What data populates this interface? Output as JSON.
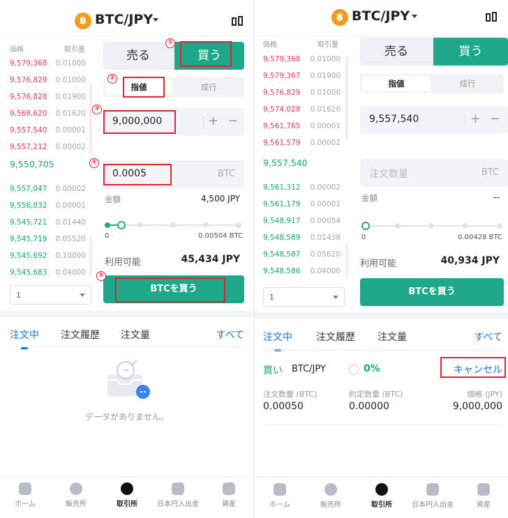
{
  "left": {
    "header": {
      "pair": "BTC/JPY",
      "coin_glyph": "฿"
    },
    "orderbook": {
      "price_header": "価格",
      "qty_header": "取引量",
      "asks": [
        {
          "price": "9,579,368",
          "qty": "0.01000"
        },
        {
          "price": "9,576,829",
          "qty": "0.01000"
        },
        {
          "price": "9,576,828",
          "qty": "0.01900"
        },
        {
          "price": "9,568,620",
          "qty": "0.01620"
        },
        {
          "price": "9,557,540",
          "qty": "0.00001"
        },
        {
          "price": "9,557,212",
          "qty": "0.00002"
        }
      ],
      "mid": "9,550,705",
      "bids": [
        {
          "price": "9,557,047",
          "qty": "0.00002"
        },
        {
          "price": "9,556,832",
          "qty": "0.00001"
        },
        {
          "price": "9,545,721",
          "qty": "0.01440"
        },
        {
          "price": "9,545,719",
          "qty": "0.05520"
        },
        {
          "price": "9,545,692",
          "qty": "0.10000"
        },
        {
          "price": "9,545,683",
          "qty": "0.04000"
        }
      ],
      "group_value": "1"
    },
    "form": {
      "sell_label": "売る",
      "buy_label": "買う",
      "limit_label": "指値",
      "market_label": "成行",
      "price_value": "9,000,000",
      "qty_value": "0.0005",
      "qty_unit": "BTC",
      "amount_label": "金額",
      "amount_value": "4,500 JPY",
      "slider_min": "0",
      "slider_max": "0.00504 BTC",
      "slider_fraction": 0.12,
      "avail_label": "利用可能",
      "avail_value": "45,434 JPY",
      "submit_label": "BTCを買う"
    },
    "tabs": {
      "open": "注文中",
      "history": "注文履歴",
      "volume": "注文量",
      "all": "すべて"
    },
    "empty_text": "データがありません。",
    "callouts": {
      "n1": "①",
      "n2": "②",
      "n3": "③",
      "n4": "④",
      "n5": "⑤"
    }
  },
  "right": {
    "header": {
      "pair": "BTC/JPY",
      "coin_glyph": "฿"
    },
    "orderbook": {
      "price_header": "価格",
      "qty_header": "取引量",
      "asks": [
        {
          "price": "9,579,368",
          "qty": "0.01000"
        },
        {
          "price": "9,579,367",
          "qty": "0.01900"
        },
        {
          "price": "9,576,829",
          "qty": "0.01000"
        },
        {
          "price": "9,574,028",
          "qty": "0.01620"
        },
        {
          "price": "9,561,765",
          "qty": "0.00001"
        },
        {
          "price": "9,561,579",
          "qty": "0.00002"
        }
      ],
      "mid": "9,557,540",
      "bids": [
        {
          "price": "9,561,312",
          "qty": "0.00002"
        },
        {
          "price": "9,561,179",
          "qty": "0.00001"
        },
        {
          "price": "9,548,917",
          "qty": "0.00054"
        },
        {
          "price": "9,548,589",
          "qty": "0.01438"
        },
        {
          "price": "9,548,587",
          "qty": "0.05620"
        },
        {
          "price": "9,548,586",
          "qty": "0.04000"
        }
      ],
      "group_value": "1"
    },
    "form": {
      "sell_label": "売る",
      "buy_label": "買う",
      "limit_label": "指値",
      "market_label": "成行",
      "price_value": "9,557,540",
      "qty_placeholder": "注文数量",
      "qty_unit": "BTC",
      "amount_label": "金額",
      "amount_value": "--",
      "slider_min": "0",
      "slider_max": "0.00428 BTC",
      "slider_fraction": 0,
      "avail_label": "利用可能",
      "avail_value": "40,934 JPY",
      "submit_label": "BTCを買う"
    },
    "tabs": {
      "open": "注文中",
      "history": "注文履歴",
      "volume": "注文量",
      "all": "すべて"
    },
    "open_order": {
      "side": "買い",
      "pair": "BTC/JPY",
      "progress": "0%",
      "cancel": "キャンセル",
      "qty_header": "注文数量 (BTC)",
      "filled_header": "約定数量 (BTC)",
      "price_header": "価格 (JPY)",
      "qty": "0.00050",
      "filled": "0.00000",
      "price": "9,000,000"
    }
  },
  "nav": [
    {
      "label": "ホーム",
      "icon": "home-icon"
    },
    {
      "label": "販売所",
      "icon": "exchange-icon"
    },
    {
      "label": "取引所",
      "icon": "trade-icon"
    },
    {
      "label": "日本円入出金",
      "icon": "deposit-icon"
    },
    {
      "label": "資産",
      "icon": "wallet-icon"
    }
  ],
  "colors": {
    "accent": "#1ea889",
    "ask": "#e14152",
    "bid": "#16a57d",
    "link": "#1573d6",
    "annotation": "#e0242f",
    "coin": "#f39a1f"
  }
}
